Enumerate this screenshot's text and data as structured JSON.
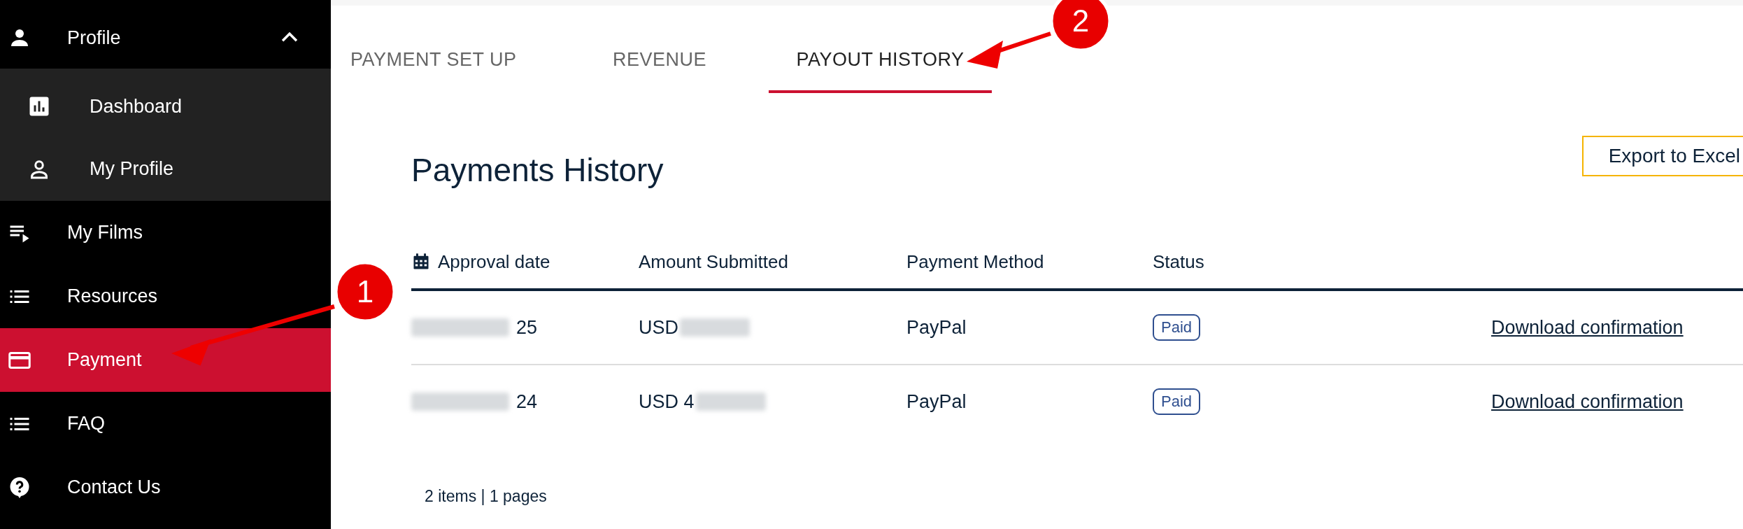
{
  "sidebar": {
    "items": [
      {
        "label": "Profile",
        "selected": false,
        "expanded": true,
        "children": [
          {
            "label": "Dashboard",
            "selected": false
          },
          {
            "label": "My Profile",
            "selected": false
          }
        ]
      },
      {
        "label": "My Films",
        "selected": false
      },
      {
        "label": "Resources",
        "selected": false
      },
      {
        "label": "Payment",
        "selected": true
      },
      {
        "label": "FAQ",
        "selected": false
      },
      {
        "label": "Contact Us",
        "selected": false
      }
    ]
  },
  "tabs": [
    {
      "label": "PAYMENT SET UP",
      "selected": false
    },
    {
      "label": "REVENUE",
      "selected": false
    },
    {
      "label": "PAYOUT HISTORY",
      "selected": true
    }
  ],
  "title": "Payments History",
  "export_button": "Export to Excel",
  "table": {
    "columns": [
      "Approval date",
      "Amount Submitted",
      "Payment Method",
      "Status"
    ],
    "rows": [
      {
        "approval_date": {
          "text": "25",
          "redacted": true
        },
        "amount": {
          "text": "USD",
          "redacted": true
        },
        "method": "PayPal",
        "status": "Paid",
        "action": "Download confirmation"
      },
      {
        "approval_date": {
          "text": "24",
          "redacted": true
        },
        "amount": {
          "text": "USD 4",
          "redacted": true
        },
        "method": "PayPal",
        "status": "Paid",
        "action": "Download confirmation"
      }
    ]
  },
  "footer": "2 items | 1 pages",
  "annotations": [
    {
      "label": "1"
    },
    {
      "label": "2"
    }
  ]
}
